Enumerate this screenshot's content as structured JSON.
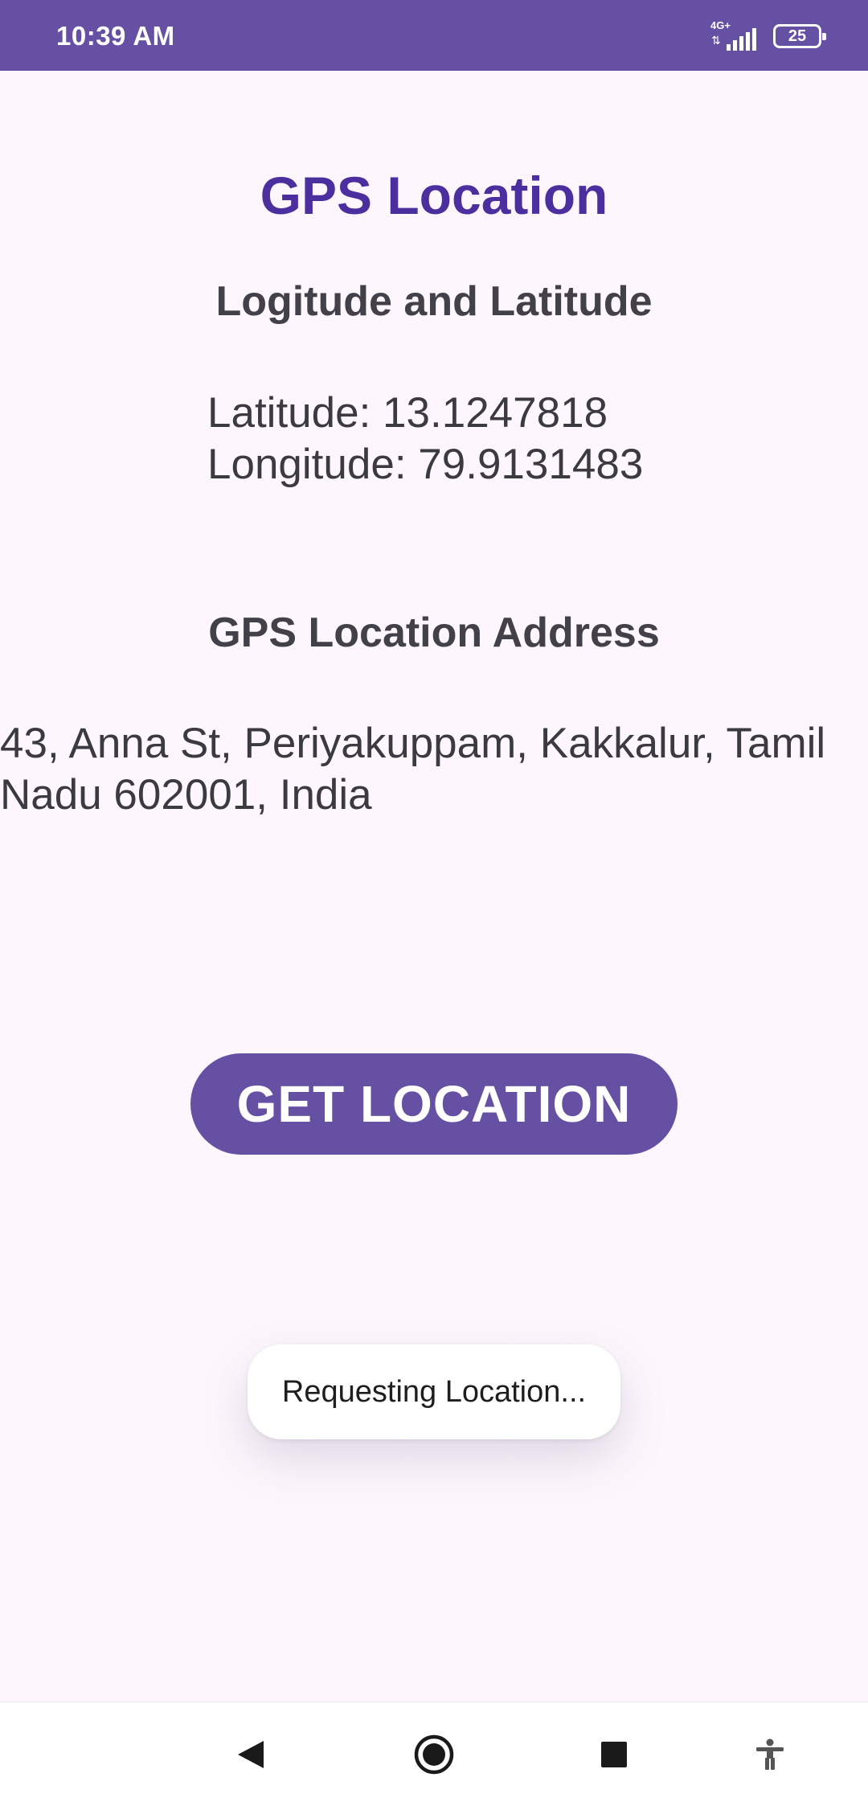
{
  "status_bar": {
    "time": "10:39 AM",
    "network": "4G+",
    "battery": "25"
  },
  "app": {
    "title": "GPS Location"
  },
  "coordinates": {
    "heading": "Logitude and Latitude",
    "latitude_line": "Latitude: 13.1247818",
    "longitude_line": "Longitude: 79.9131483"
  },
  "address": {
    "heading": "GPS Location Address",
    "line1": "43, Anna St, Periyakuppam, Kakkalur, Tamil",
    "line2": "Nadu 602001, India"
  },
  "actions": {
    "get_location_label": "GET LOCATION"
  },
  "toast": {
    "message": "Requesting Location..."
  },
  "nav_bar": {
    "icons": [
      "back-icon",
      "home-icon",
      "recents-icon",
      "accessibility-icon"
    ]
  },
  "colors": {
    "primary": "#6650a4",
    "title": "#4c2f9e",
    "background": "#fdf7fd"
  }
}
